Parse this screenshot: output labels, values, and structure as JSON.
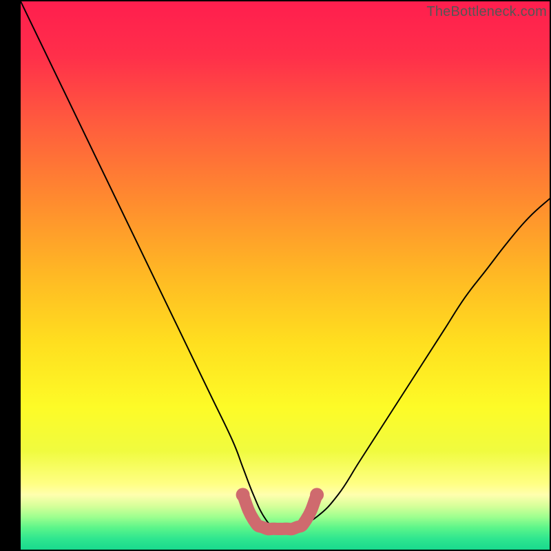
{
  "watermark": "TheBottleneck.com",
  "chart_data": {
    "type": "line",
    "title": "",
    "xlabel": "",
    "ylabel": "",
    "xlim": [
      0,
      100
    ],
    "ylim": [
      0,
      100
    ],
    "grid": false,
    "legend": false,
    "series": [
      {
        "name": "bottleneck-curve",
        "color": "#000000",
        "x": [
          0,
          4,
          8,
          12,
          16,
          20,
          24,
          28,
          32,
          36,
          40,
          42,
          44,
          46,
          48,
          50,
          52,
          56,
          60,
          64,
          68,
          72,
          76,
          80,
          84,
          88,
          92,
          96,
          100
        ],
        "y": [
          100,
          92,
          84,
          76,
          68,
          60,
          52,
          44,
          36,
          28,
          20,
          15,
          10,
          6,
          4,
          4,
          4,
          6,
          10,
          16,
          22,
          28,
          34,
          40,
          46,
          51,
          56,
          60.5,
          64
        ]
      },
      {
        "name": "optimal-range-marker",
        "color": "#cf6a6e",
        "x": [
          42,
          44,
          46,
          48,
          50,
          52,
          54,
          56
        ],
        "y": [
          10,
          5.5,
          4,
          3.8,
          3.8,
          4,
          5.5,
          10
        ]
      }
    ],
    "background": {
      "type": "vertical-gradient",
      "stops": [
        {
          "pos": 0.0,
          "color": "#ff1e4e"
        },
        {
          "pos": 0.1,
          "color": "#ff2f4a"
        },
        {
          "pos": 0.22,
          "color": "#ff5b3e"
        },
        {
          "pos": 0.36,
          "color": "#ff8a2f"
        },
        {
          "pos": 0.5,
          "color": "#ffb924"
        },
        {
          "pos": 0.62,
          "color": "#ffde1f"
        },
        {
          "pos": 0.74,
          "color": "#fdfb27"
        },
        {
          "pos": 0.82,
          "color": "#f0fb3f"
        },
        {
          "pos": 0.88,
          "color": "#ffff84"
        },
        {
          "pos": 0.9,
          "color": "#ffffae"
        },
        {
          "pos": 0.92,
          "color": "#d7ff9a"
        },
        {
          "pos": 0.94,
          "color": "#9fff8f"
        },
        {
          "pos": 0.96,
          "color": "#5cf58a"
        },
        {
          "pos": 0.98,
          "color": "#2fe68f"
        },
        {
          "pos": 1.0,
          "color": "#19d98e"
        }
      ]
    }
  }
}
